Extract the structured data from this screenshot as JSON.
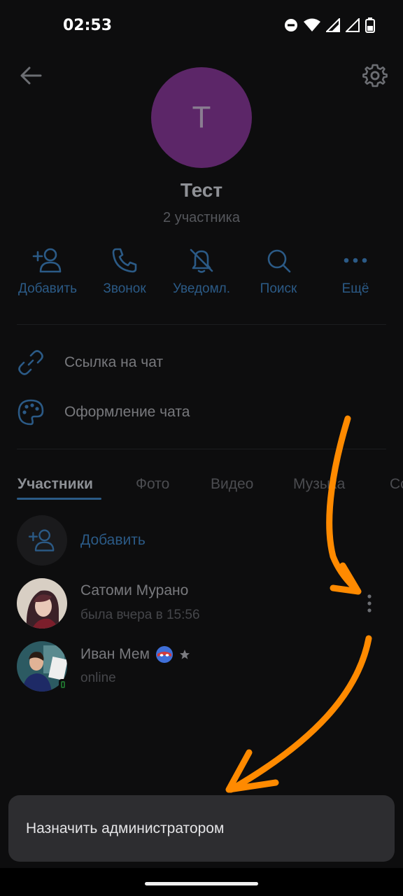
{
  "status_bar": {
    "time": "02:53"
  },
  "header": {
    "title": "Тест",
    "subtitle": "2 участника",
    "avatar_letter": "Т"
  },
  "actions": [
    {
      "label": "Добавить",
      "icon": "add-user-icon"
    },
    {
      "label": "Звонок",
      "icon": "phone-icon"
    },
    {
      "label": "Уведомл.",
      "icon": "bell-off-icon"
    },
    {
      "label": "Поиск",
      "icon": "search-icon"
    },
    {
      "label": "Ещё",
      "icon": "more-icon"
    }
  ],
  "menu": [
    {
      "label": "Ссылка на чат",
      "icon": "link-icon"
    },
    {
      "label": "Оформление чата",
      "icon": "palette-icon"
    }
  ],
  "tabs": [
    "Участники",
    "Фото",
    "Видео",
    "Музыка",
    "Ссылки"
  ],
  "members": {
    "add_label": "Добавить",
    "items": [
      {
        "name": "Сатоми Мурано",
        "status": "была вчера в 15:56"
      },
      {
        "name": "Иван Мем",
        "status": "online"
      }
    ]
  },
  "context_menu": {
    "item": "Назначить администратором"
  },
  "colors": {
    "accent": "#2b5a86",
    "avatar": "#5c2668",
    "arrow": "#ff8a00",
    "background": "#0d0d0e"
  }
}
